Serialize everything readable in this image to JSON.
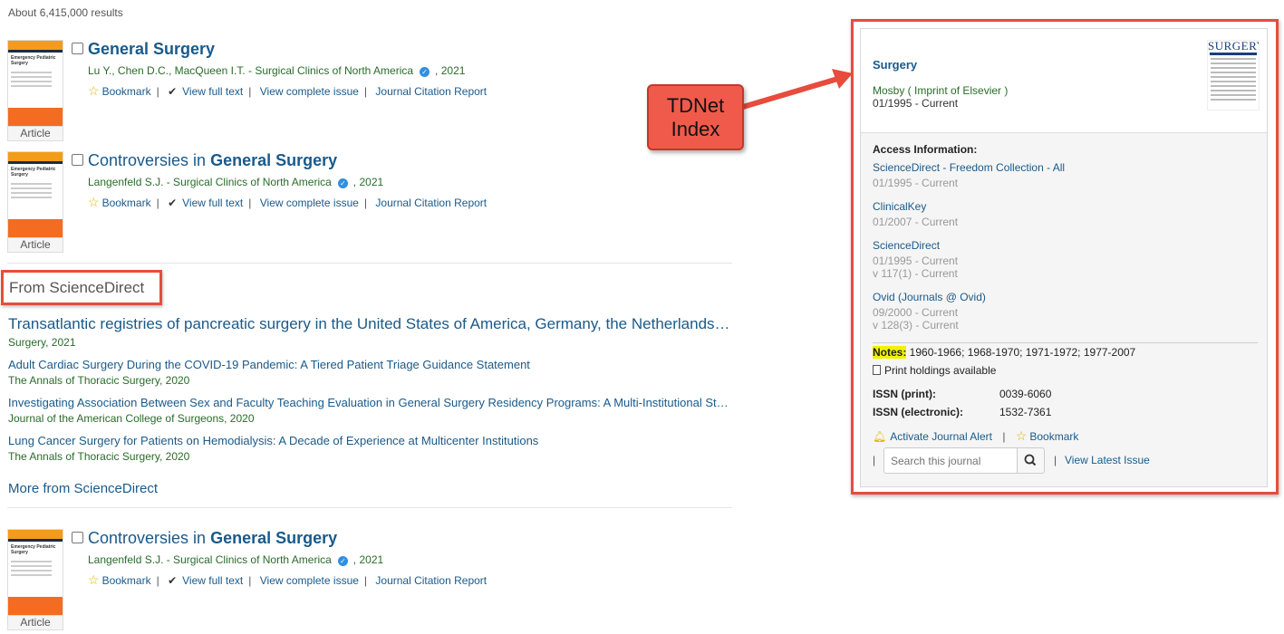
{
  "results_count": "About 6,415,000 results",
  "results": [
    {
      "type_label": "Article",
      "title_pre": "",
      "title_bold": "General Surgery",
      "meta": "Lu Y., Chen D.C., MacQueen I.T. - Surgical Clinics of North America",
      "year": ", 2021",
      "cover_text": "Emergency Pediatric Surgery"
    },
    {
      "type_label": "Article",
      "title_pre": "Controversies in ",
      "title_bold": "General Surgery",
      "meta": "Langenfeld S.J. - Surgical Clinics of North America",
      "year": ", 2021",
      "cover_text": "Emergency Pediatric Surgery"
    },
    {
      "type_label": "Article",
      "title_pre": "Controversies in ",
      "title_bold": "General Surgery",
      "meta": "Langenfeld S.J. - Surgical Clinics of North America",
      "year": ", 2021",
      "cover_text": "Emergency Pediatric Surgery"
    }
  ],
  "actions": {
    "bookmark": "Bookmark",
    "view_full_text": "View full text",
    "view_issue": "View complete issue",
    "citation_report": "Journal Citation Report"
  },
  "sciencedirect": {
    "header": "From ScienceDirect",
    "items": [
      {
        "title": "Transatlantic registries of pancreatic surgery in the United States of America, Germany, the Netherlands,…",
        "source": "Surgery, 2021"
      },
      {
        "title": "Adult Cardiac Surgery During the COVID-19 Pandemic: A Tiered Patient Triage Guidance Statement",
        "source": "The Annals of Thoracic Surgery, 2020"
      },
      {
        "title": "Investigating Association Between Sex and Faculty Teaching Evaluation in General Surgery Residency Programs: A Multi-Institutional St…",
        "source": "Journal of the American College of Surgeons, 2020"
      },
      {
        "title": "Lung Cancer Surgery for Patients on Hemodialysis: A Decade of Experience at Multicenter Institutions",
        "source": "The Annals of Thoracic Surgery, 2020"
      }
    ],
    "more": "More from ScienceDirect"
  },
  "callout": {
    "line1": "TDNet",
    "line2": "Index"
  },
  "journal": {
    "title": "Surgery",
    "publisher": "Mosby ( Imprint of Elsevier )",
    "range": "01/1995 - Current",
    "cover_title": "SURGERY",
    "access_header": "Access Information:",
    "access": [
      {
        "name": "ScienceDirect - Freedom Collection - All",
        "range": "01/1995 - Current",
        "range2": ""
      },
      {
        "name": "ClinicalKey",
        "range": "01/2007 - Current",
        "range2": ""
      },
      {
        "name": "ScienceDirect",
        "range": "01/1995 - Current",
        "range2": "v 117(1) - Current"
      },
      {
        "name": "Ovid (Journals @ Ovid)",
        "range": "09/2000 - Current",
        "range2": "v 128(3) - Current"
      }
    ],
    "notes_label": "Notes:",
    "notes_text": " 1960-1966; 1968-1970; 1971-1972; 1977-2007",
    "print_holdings": "Print holdings available",
    "issn_print_label": "ISSN (print):",
    "issn_print": "0039-6060",
    "issn_electronic_label": "ISSN (electronic):",
    "issn_electronic": "1532-7361",
    "activate_alert": "Activate Journal Alert",
    "bookmark": "Bookmark",
    "search_placeholder": "Search this journal",
    "view_latest": "View Latest Issue"
  },
  "colors": {
    "link": "#1a5a8a",
    "source_green": "#2a6b2a",
    "annotation_red": "#e74c3c",
    "highlight_yellow": "#f2f200"
  }
}
